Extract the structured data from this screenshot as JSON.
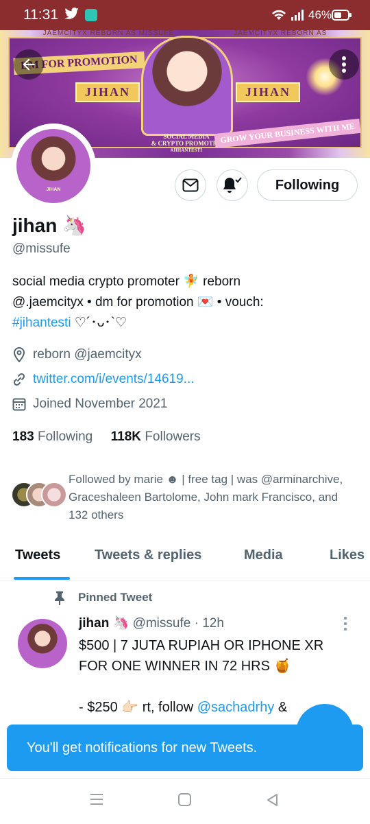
{
  "status_bar": {
    "time": "11:31",
    "battery": "46%"
  },
  "banner": {
    "top_text_left": "JAEMCITYX REBORN AS MISSUFE",
    "top_text_right": "JAEMCITYX REBORN AS MISSUFE",
    "promo_tag": "DM FOR PROMOTION",
    "name_left": "JIHAN",
    "name_right": "JIHAN",
    "caption_line1": "SOCIAL MEDIA",
    "caption_line2": "& CRYPTO PROMOTER",
    "caption_tag": "#JIHANTESTI",
    "grow_tag": "GROW YOUR BUSINESS WITH ME",
    "avatar_label": "JIHAN"
  },
  "profile": {
    "display_name": "jihan 🦄",
    "handle": "@missufe",
    "following_button": "Following",
    "bio_line1": "social media crypto promoter 🧚 reborn",
    "bio_line2": "@.jaemcityx • dm for promotion 💌 • vouch:",
    "bio_hashtag": "#jihantesti",
    "bio_tail": " ♡´･ᴗ･`♡",
    "location": "reborn @jaemcityx",
    "website": "twitter.com/i/events/14619...",
    "joined": "Joined November 2021",
    "following_count": "183",
    "following_label": "Following",
    "followers_count": "118K",
    "followers_label": "Followers",
    "followed_by": "Followed by marie ☻ | free tag | was @arminarchive, Graceshaleen Bartolome, John mark Francisco, and 132 others"
  },
  "tabs": [
    {
      "label": "Tweets"
    },
    {
      "label": "Tweets & replies"
    },
    {
      "label": "Media"
    },
    {
      "label": "Likes"
    }
  ],
  "tweet": {
    "pinned_label": "Pinned Tweet",
    "author": "jihan 🦄",
    "meta": "@missufe · 12h",
    "line1": "$500 | 7 JUTA RUPIAH OR IPHONE XR",
    "line2": "FOR ONE WINNER IN 72 HRS 🍯",
    "line3_prefix": "- $250 👉🏻 rt, follow ",
    "line3_mention": "@sachadrhy",
    "line3_suffix": " &"
  },
  "toast": {
    "text": "You'll get notifications for new Tweets."
  },
  "colors": {
    "accent": "#1d9bf0",
    "status_bar": "#8b2d2e",
    "muted": "#536471"
  }
}
